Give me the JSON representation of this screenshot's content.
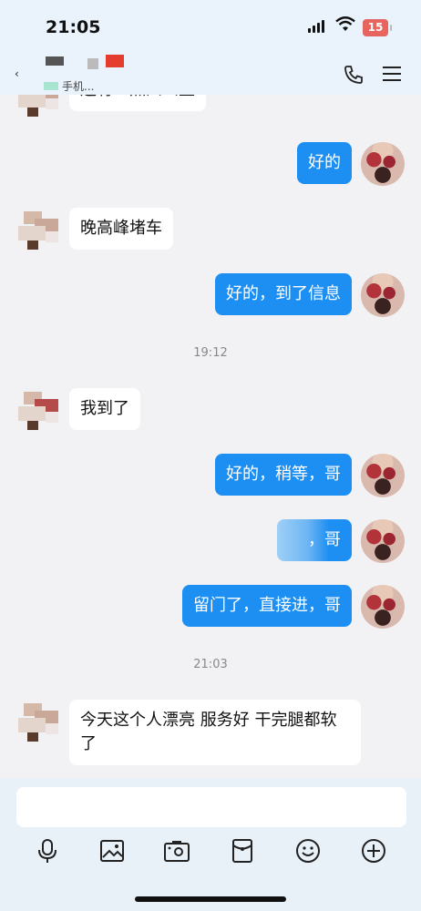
{
  "status_bar": {
    "time": "21:05",
    "battery": "15"
  },
  "header": {
    "back": "‹",
    "contact_sub": "手机..."
  },
  "messages": {
    "m0": "还有一点四公里",
    "m1": "好的",
    "m2": "晚高峰堵车",
    "m3": "好的，到了信息",
    "t1": "19:12",
    "m4": "我到了",
    "m5": "好的，稍等，哥",
    "m6": "，哥",
    "m7": "留门了，直接进，哥",
    "t2": "21:03",
    "m8": "今天这个人漂亮 服务好 干完腿都软了"
  },
  "colors": {
    "accent": "#1d8ef2",
    "header_bg": "#eaf2fb",
    "chat_bg": "#f2f2f4"
  },
  "icons": [
    "phone-icon",
    "menu-icon",
    "microphone-icon",
    "image-icon",
    "camera-icon",
    "red-packet-icon",
    "emoji-icon",
    "plus-icon"
  ]
}
